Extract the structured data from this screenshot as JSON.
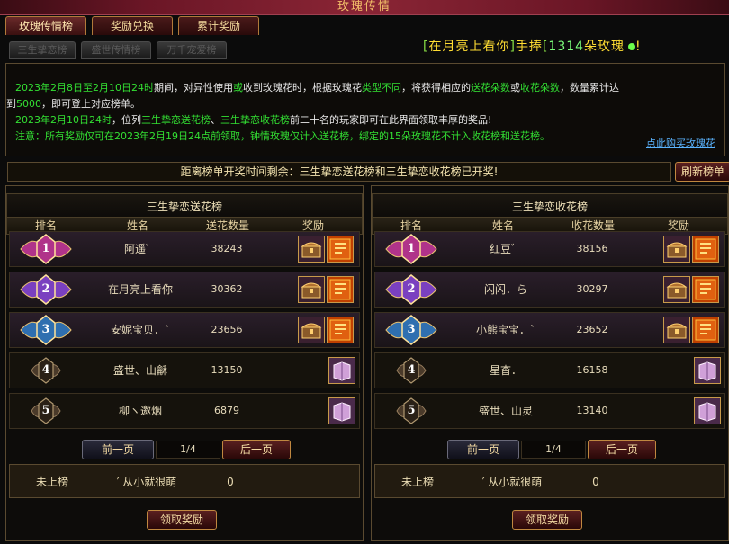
{
  "window": {
    "title": "玫瑰传情"
  },
  "tabs": [
    "玫瑰传情榜",
    "奖励兑换",
    "累计奖励"
  ],
  "subtabs": [
    "三生挚恋榜",
    "盛世传情榜",
    "万千宠爱榜"
  ],
  "banner": {
    "open": "[",
    "name": "在月亮上看你",
    "close": "]",
    "verb": "手捧",
    "open2": "[",
    "count": "1314",
    "unit": "朵玫瑰",
    "tail": "!"
  },
  "notice": {
    "line1": {
      "date": "2023年2月8日至2月10日24时",
      "a": "期间，对异性使用",
      "or1": "或",
      "b": "收到玫瑰花",
      "c": "时，根据玫瑰花",
      "d": "类型不同",
      "e": "，将获得相应的",
      "f": "送花朵数",
      "or2": "或",
      "g": "收花朵数",
      "h": "，数量累计达"
    },
    "line2": {
      "a": "到",
      "num": "5000",
      "b": "，即可登上对应榜单。"
    },
    "line3": {
      "a": "2023年2月10日24时",
      "b": "，位列",
      "c": "三生挚恋送花榜",
      "d": "、",
      "e": "三生挚恋收花榜",
      "f": "前二十名",
      "g": "的玩家即可在此界面领取丰厚的奖品!"
    },
    "line4": {
      "a": "注意：所有奖励仅可在",
      "b": "2023年2月19日24点",
      "c": "前领取，钟情玫瑰仅计入送花榜，绑定的15朵玫瑰花不计入收花榜和送花榜。"
    },
    "buy_link": "点此购买玫瑰花"
  },
  "countdown": "距离榜单开奖时间剩余：三生挚恋送花榜和三生挚恋收花榜已开奖!",
  "refresh_label": "刷新榜单",
  "panels": [
    {
      "title": "三生挚恋送花榜",
      "headers": [
        "排名",
        "姓名",
        "送花数量",
        "奖励"
      ],
      "rows": [
        {
          "rank": "1",
          "name": "阿遥゛",
          "count": "38243"
        },
        {
          "rank": "2",
          "name": "在月亮上看你",
          "count": "30362"
        },
        {
          "rank": "3",
          "name": "安妮宝贝．`",
          "count": "23656"
        },
        {
          "rank": "4",
          "name": "盛世、山龢",
          "count": "13150"
        },
        {
          "rank": "5",
          "name": "柳ヽ邀烟",
          "count": "6879"
        }
      ],
      "pager": {
        "prev": "前一页",
        "page": "1/4",
        "next": "后一页"
      },
      "mine": {
        "status": "未上榜",
        "name": "′ 从小就很萌",
        "count": "0"
      },
      "claim": "领取奖励"
    },
    {
      "title": "三生挚恋收花榜",
      "headers": [
        "排名",
        "姓名",
        "收花数量",
        "奖励"
      ],
      "rows": [
        {
          "rank": "1",
          "name": "红豆゛",
          "count": "38156"
        },
        {
          "rank": "2",
          "name": "闪闪．ら",
          "count": "30297"
        },
        {
          "rank": "3",
          "name": "小熊宝宝．`",
          "count": "23652"
        },
        {
          "rank": "4",
          "name": "星杳．",
          "count": "16158"
        },
        {
          "rank": "5",
          "name": "盛世、山灵",
          "count": "13140"
        }
      ],
      "pager": {
        "prev": "前一页",
        "page": "1/4",
        "next": "后一页"
      },
      "mine": {
        "status": "未上榜",
        "name": "′ 从小就很萌",
        "count": "0"
      },
      "claim": "领取奖励"
    }
  ],
  "colors": {
    "rank1": "#b0338a",
    "rank2": "#7a40c0",
    "rank3": "#2f6fb0",
    "rank_other": "#4a3a2a",
    "accent": "#c08840"
  },
  "icons": {
    "chest": "treasure-chest-icon",
    "title_card": "title-card-icon",
    "book": "book-icon"
  }
}
